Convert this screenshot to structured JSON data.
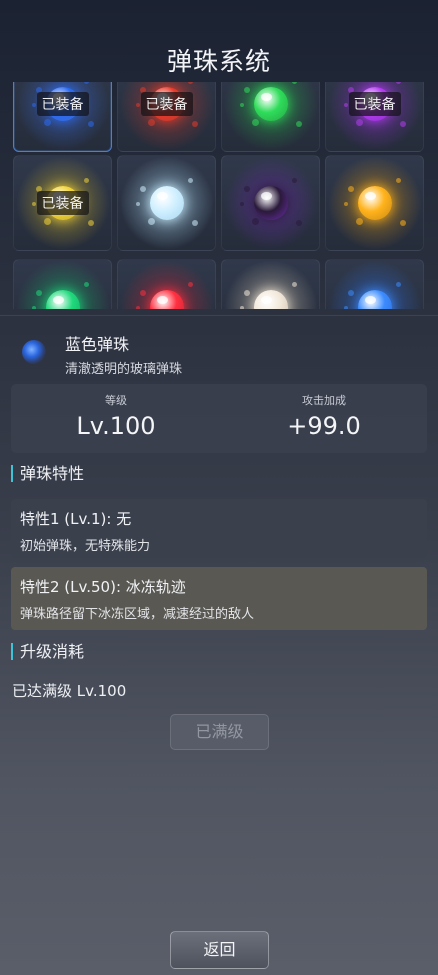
{
  "header": {
    "title": "弹珠系统"
  },
  "grid": {
    "items": [
      {
        "name": "blue-marble",
        "color": "#2b6af0",
        "glow": "#3b6ad8",
        "badge": "已装备",
        "selected": true
      },
      {
        "name": "red-marble",
        "color": "#e83a2a",
        "glow": "#b83a2e",
        "badge": "已装备",
        "selected": false
      },
      {
        "name": "green-marble",
        "color": "#2fdc5a",
        "glow": "#26a845",
        "badge": "",
        "selected": false
      },
      {
        "name": "purple-marble",
        "color": "#b43cf0",
        "glow": "#8a2fc8",
        "badge": "已装备",
        "selected": false
      },
      {
        "name": "gold-marble",
        "color": "#f2d43a",
        "glow": "#c4a92a",
        "badge": "已装备",
        "selected": false
      },
      {
        "name": "ice-marble",
        "color": "#cfefff",
        "glow": "#a8d6ee",
        "badge": "",
        "selected": false
      },
      {
        "name": "dark-marble",
        "color": "#2a1a3a",
        "glow": "#6a2ea8",
        "badge": "",
        "selected": false
      },
      {
        "name": "amber-marble",
        "color": "#ffb21a",
        "glow": "#c88a18",
        "badge": "",
        "selected": false
      },
      {
        "name": "emerald-marble",
        "color": "#1fd97c",
        "glow": "#18a862",
        "badge": "",
        "selected": false
      },
      {
        "name": "crimson-marble",
        "color": "#ff3040",
        "glow": "#c02636",
        "badge": "",
        "selected": false
      },
      {
        "name": "pearl-marble",
        "color": "#f2e8da",
        "glow": "#c8bca8",
        "badge": "",
        "selected": false
      },
      {
        "name": "sapphire-marble",
        "color": "#3c8cff",
        "glow": "#2e6ad6",
        "badge": "",
        "selected": false
      }
    ]
  },
  "selected": {
    "name": "蓝色弹珠",
    "description": "清澈透明的玻璃弹珠",
    "icon_color": "#2a66e0"
  },
  "stats": {
    "level_label": "等级",
    "level_value": "Lv.100",
    "attack_label": "攻击加成",
    "attack_value": "+99.0"
  },
  "traits": {
    "section_title": "弹珠特性",
    "items": [
      {
        "title": "特性1 (Lv.1): 无",
        "desc": "初始弹珠，无特殊能力",
        "bg": "#3b404d"
      },
      {
        "title": "特性2 (Lv.50): 冰冻轨迹",
        "desc": "弹珠路径留下冰冻区域，减速经过的敌人",
        "bg": "#5a5852"
      }
    ]
  },
  "upgrade": {
    "section_title": "升级消耗",
    "status": "已达满级 Lv.100",
    "button_label": "已满级"
  },
  "footer": {
    "back_label": "返回"
  }
}
